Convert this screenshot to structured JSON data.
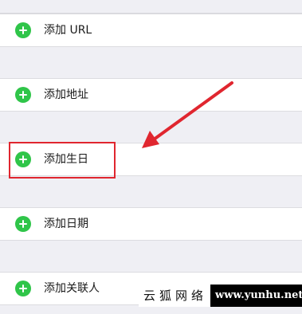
{
  "rows": [
    {
      "label": "添加 URL",
      "icon": "add-circle-icon"
    },
    {
      "label": "添加地址",
      "icon": "add-circle-icon"
    },
    {
      "label": "添加生日",
      "icon": "add-circle-icon"
    },
    {
      "label": "添加日期",
      "icon": "add-circle-icon"
    },
    {
      "label": "添加关联人",
      "icon": "add-circle-icon"
    }
  ],
  "colors": {
    "add_icon": "#2fc549",
    "annotation": "#e0262f",
    "background": "#efeff4"
  },
  "annotation": {
    "highlighted_row": "添加生日"
  },
  "watermark": {
    "text_cn": "云狐网络",
    "url": "www.yunhu.net"
  }
}
